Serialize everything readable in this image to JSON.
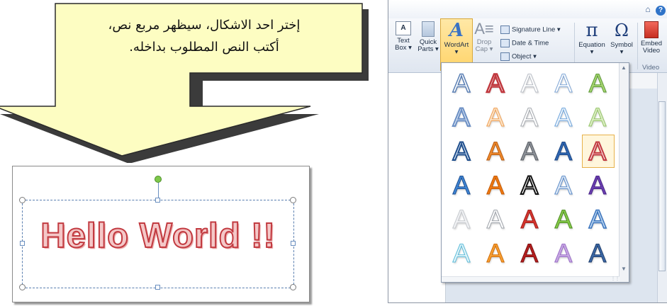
{
  "callout": {
    "line1": "إختر احد الاشكال، سيظهر مربع نص،",
    "line2": "أكتب النص المطلوب بداخله."
  },
  "example": {
    "text": "Hello World !!"
  },
  "ribbon": {
    "text_box": [
      "Text",
      "Box ▾"
    ],
    "quick_parts": [
      "Quick",
      "Parts ▾"
    ],
    "wordart": [
      "WordArt",
      "▾"
    ],
    "drop_cap": [
      "Drop",
      "Cap ▾"
    ],
    "signature_line": "Signature Line ▾",
    "date_time": "Date & Time",
    "object": "Object ▾",
    "equation": [
      "Equation",
      "▾"
    ],
    "symbol": [
      "Symbol",
      "▾"
    ],
    "embed_video": [
      "Embed",
      "Video"
    ],
    "group_video": "Video"
  },
  "gallery": {
    "glyph": "A",
    "styles": [
      [
        "outline-blue",
        "outline-red",
        "outline-gray",
        "outline-lblue",
        "grad-green"
      ],
      [
        "bevel-blue",
        "orange-soft",
        "outline-silver",
        "outline-sky",
        "green-soft"
      ],
      [
        "blue-outline-bold",
        "orange-gloss",
        "gray-gloss",
        "blue-solid",
        "red-outline-selected"
      ],
      [
        "blue-gloss",
        "orange-solid",
        "black-outline",
        "blue-light",
        "purple-shadow"
      ],
      [
        "silver-soft",
        "silver-outline",
        "red-gloss",
        "green-gloss",
        "blue-reflect"
      ],
      [
        "cyan-outline",
        "orange-bright",
        "red-dark",
        "purple-light",
        "blue-steel"
      ]
    ],
    "selected": [
      2,
      4
    ]
  },
  "colors": {
    "callout_fill": "#fdfdc2",
    "ribbon_active": "#ffd46a",
    "wordart_text": "#c23a40",
    "accent": "#2f73c8"
  }
}
